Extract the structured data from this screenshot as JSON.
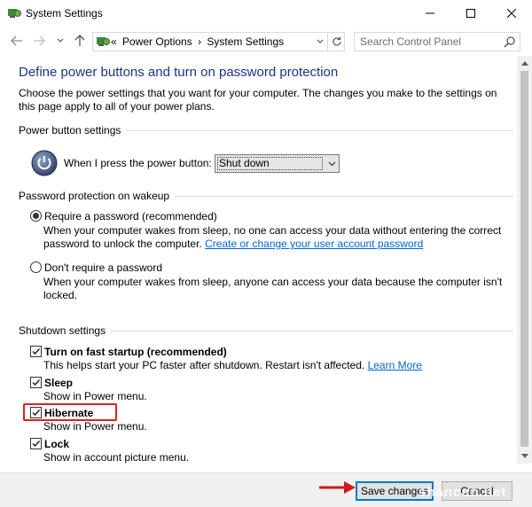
{
  "window": {
    "title": "System Settings"
  },
  "nav": {
    "breadcrumb_prefix": "«",
    "breadcrumbs": [
      "Power Options",
      "›",
      "System Settings"
    ],
    "search_placeholder": "Search Control Panel"
  },
  "page": {
    "title": "Define power buttons and turn on password protection",
    "description": "Choose the power settings that you want for your computer. The changes you make to the settings on this page apply to all of your power plans."
  },
  "power_button": {
    "section_title": "Power button settings",
    "label": "When I press the power button:",
    "selected": "Shut down"
  },
  "password": {
    "section_title": "Password protection on wakeup",
    "require": {
      "label": "Require a password (recommended)",
      "desc_1": "When your computer wakes from sleep, no one can access your data without entering the correct",
      "desc_2": "password to unlock the computer.",
      "link": "Create or change your user account password",
      "selected": true
    },
    "no_require": {
      "label": "Don't require a password",
      "desc_1": "When your computer wakes from sleep, anyone can access your data because the computer isn't",
      "desc_2": "locked.",
      "selected": false
    }
  },
  "shutdown": {
    "section_title": "Shutdown settings",
    "fast_startup": {
      "label": "Turn on fast startup (recommended)",
      "desc": "This helps start your PC faster after shutdown. Restart isn't affected.",
      "link": "Learn More",
      "checked": true
    },
    "sleep": {
      "label": "Sleep",
      "desc": "Show in Power menu.",
      "checked": true
    },
    "hibernate": {
      "label": "Hibernate",
      "desc": "Show in Power menu.",
      "checked": true
    },
    "lock": {
      "label": "Lock",
      "desc": "Show in account picture menu.",
      "checked": true
    }
  },
  "footer": {
    "save_label": "Save changes",
    "cancel_label": "Cancel",
    "watermark": "shancun.net"
  },
  "colors": {
    "title_blue": "#1e3287",
    "link_blue": "#0066cc",
    "highlight_red": "#e02020",
    "focus_blue": "#0078d7"
  }
}
